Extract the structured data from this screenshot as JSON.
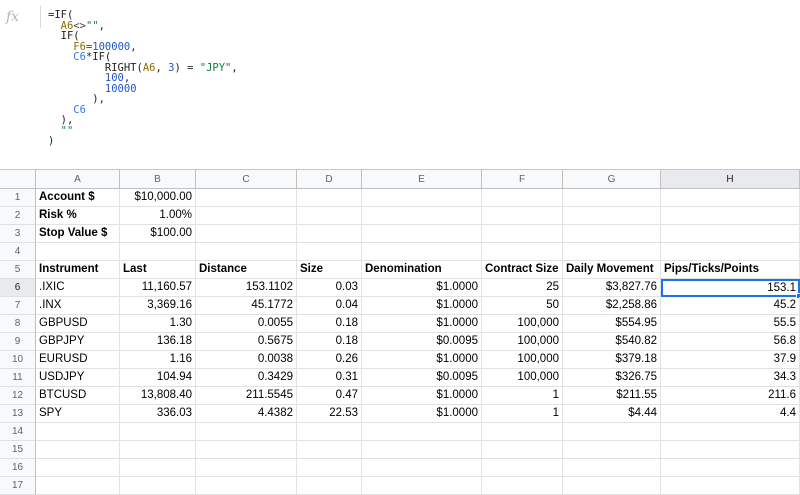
{
  "formula_bar": {
    "fx_label": "fx",
    "lines": [
      [
        {
          "t": "=IF(",
          "c": "norm"
        }
      ],
      [
        {
          "t": "  ",
          "c": "norm"
        },
        {
          "t": "A6",
          "c": "ref"
        },
        {
          "t": "<>",
          "c": "op"
        },
        {
          "t": "\"\"",
          "c": "str"
        },
        {
          "t": ",",
          "c": "norm"
        }
      ],
      [
        {
          "t": "  IF(",
          "c": "norm"
        }
      ],
      [
        {
          "t": "    ",
          "c": "norm"
        },
        {
          "t": "F6",
          "c": "ref"
        },
        {
          "t": "=",
          "c": "op"
        },
        {
          "t": "100000",
          "c": "num"
        },
        {
          "t": ",",
          "c": "norm"
        }
      ],
      [
        {
          "t": "    ",
          "c": "norm"
        },
        {
          "t": "C6",
          "c": "ref2"
        },
        {
          "t": "*IF(",
          "c": "norm"
        }
      ],
      [
        {
          "t": "         RIGHT(",
          "c": "norm"
        },
        {
          "t": "A6",
          "c": "ref"
        },
        {
          "t": ", ",
          "c": "norm"
        },
        {
          "t": "3",
          "c": "num"
        },
        {
          "t": ") = ",
          "c": "norm"
        },
        {
          "t": "\"JPY\"",
          "c": "str"
        },
        {
          "t": ",",
          "c": "norm"
        }
      ],
      [
        {
          "t": "         ",
          "c": "norm"
        },
        {
          "t": "100",
          "c": "num"
        },
        {
          "t": ",",
          "c": "norm"
        }
      ],
      [
        {
          "t": "         ",
          "c": "norm"
        },
        {
          "t": "10000",
          "c": "num"
        }
      ],
      [
        {
          "t": "       ),",
          "c": "norm"
        }
      ],
      [
        {
          "t": "    ",
          "c": "norm"
        },
        {
          "t": "C6",
          "c": "ref2"
        }
      ],
      [
        {
          "t": "  ),",
          "c": "norm"
        }
      ],
      [
        {
          "t": "  ",
          "c": "norm"
        },
        {
          "t": "\"\"",
          "c": "str"
        }
      ],
      [
        {
          "t": ")",
          "c": "norm"
        }
      ]
    ]
  },
  "columns": [
    "A",
    "B",
    "C",
    "D",
    "E",
    "F",
    "G",
    "H"
  ],
  "active_column": "H",
  "active_row": 6,
  "row_numbers": [
    "1",
    "2",
    "3",
    "4",
    "5",
    "6",
    "7",
    "8",
    "9",
    "10",
    "11",
    "12",
    "13",
    "14",
    "15",
    "16",
    "17"
  ],
  "rows": [
    {
      "A": "Account $",
      "B": "$10,000.00"
    },
    {
      "A": "Risk %",
      "B": "1.00%"
    },
    {
      "A": "Stop Value $",
      "B": "$100.00"
    },
    {},
    {
      "A": "Instrument",
      "B": "Last",
      "C": "Distance",
      "D": "Size",
      "E": "Denomination",
      "F": "Contract Size",
      "G": "Daily Movement",
      "H": "Pips/Ticks/Points"
    },
    {
      "A": ".IXIC",
      "B": "11,160.57",
      "C": "153.1102",
      "D": "0.03",
      "E": "$1.0000",
      "F": "25",
      "G": "$3,827.76",
      "H": "153.1"
    },
    {
      "A": ".INX",
      "B": "3,369.16",
      "C": "45.1772",
      "D": "0.04",
      "E": "$1.0000",
      "F": "50",
      "G": "$2,258.86",
      "H": "45.2"
    },
    {
      "A": "GBPUSD",
      "B": "1.30",
      "C": "0.0055",
      "D": "0.18",
      "E": "$1.0000",
      "F": "100,000",
      "G": "$554.95",
      "H": "55.5"
    },
    {
      "A": "GBPJPY",
      "B": "136.18",
      "C": "0.5675",
      "D": "0.18",
      "E": "$0.0095",
      "F": "100,000",
      "G": "$540.82",
      "H": "56.8"
    },
    {
      "A": "EURUSD",
      "B": "1.16",
      "C": "0.0038",
      "D": "0.26",
      "E": "$1.0000",
      "F": "100,000",
      "G": "$379.18",
      "H": "37.9"
    },
    {
      "A": "USDJPY",
      "B": "104.94",
      "C": "0.3429",
      "D": "0.31",
      "E": "$0.0095",
      "F": "100,000",
      "G": "$326.75",
      "H": "34.3"
    },
    {
      "A": "BTCUSD",
      "B": "13,808.40",
      "C": "211.5545",
      "D": "0.47",
      "E": "$1.0000",
      "F": "1",
      "G": "$211.55",
      "H": "211.6"
    },
    {
      "A": "SPY",
      "B": "336.03",
      "C": "4.4382",
      "D": "22.53",
      "E": "$1.0000",
      "F": "1",
      "G": "$4.44",
      "H": "4.4"
    },
    {},
    {},
    {},
    {}
  ]
}
